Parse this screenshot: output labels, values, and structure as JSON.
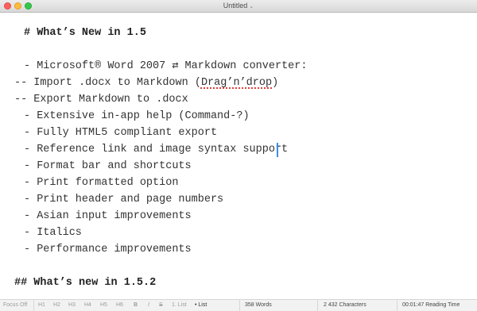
{
  "window": {
    "title": "Untitled",
    "title_chevron": "⌄"
  },
  "editor": {
    "lines": [
      "# What’s New in 1.5",
      "",
      "- Microsoft® Word 2007 ⇄ Markdown converter:",
      "-- Import .docx to Markdown (",
      "-- Export Markdown to .docx",
      "- Extensive in-app help (Command-?)",
      "- Fully HTML5 compliant export",
      "- Reference link and image syntax support",
      "- Format bar and shortcuts",
      "- Print formatted option",
      "- Print header and page numbers",
      "- Asian input improvements",
      "- Italics",
      "- Performance improvements",
      "",
      "## What’s new in 1.5.2"
    ],
    "misspelled_word": "Drag’n’drop",
    "line3_tail": ")"
  },
  "statusbar": {
    "focus_off": "Focus Off",
    "h1": "H1",
    "h2": "H2",
    "h3": "H3",
    "h4": "H4",
    "h5": "H5",
    "h6": "H6",
    "bold": "B",
    "italic": "I",
    "strike": "S",
    "numbered_list": "1. List",
    "bullet_list": "• List",
    "words": "358 Words",
    "characters": "2 432 Characters",
    "reading_time": "00:01:47 Reading Time"
  },
  "colors": {
    "cursor": "#3a8ef0",
    "spellcheck": "#e0403a"
  }
}
